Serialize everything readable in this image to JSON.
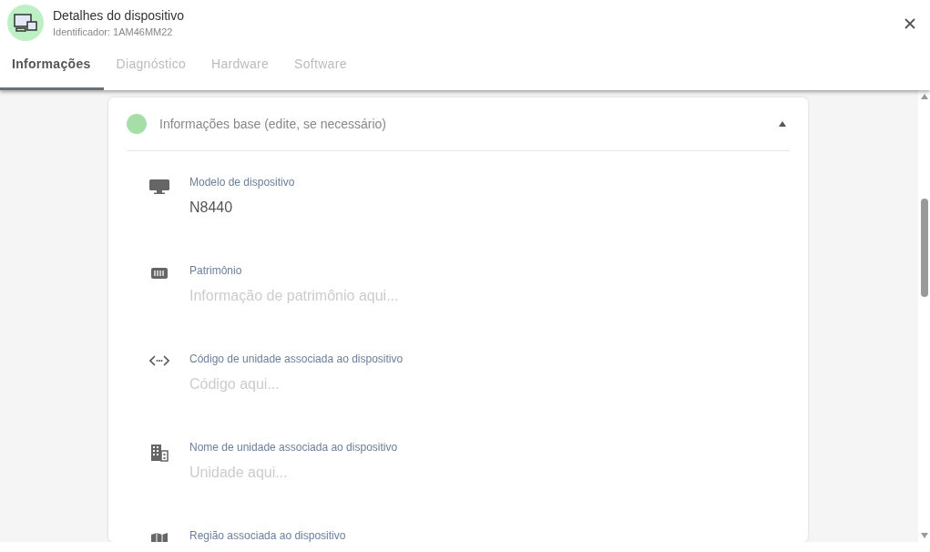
{
  "header": {
    "title": "Detalhes do dispositivo",
    "subtitle": "Identificador: 1AM46MM22"
  },
  "tabs": [
    {
      "label": "Informações",
      "selected": true
    },
    {
      "label": "Diagnóstico",
      "selected": false
    },
    {
      "label": "Hardware",
      "selected": false
    },
    {
      "label": "Software",
      "selected": false
    }
  ],
  "section": {
    "title": "Informações base (edite, se necessário)",
    "expanded": true,
    "fields": [
      {
        "kind": "monitor",
        "label": "Modelo de dispositivo",
        "value": "N8440"
      },
      {
        "kind": "tag",
        "label": "Patrimônio",
        "placeholder": "Informação de patrimônio aqui..."
      },
      {
        "kind": "code",
        "label": "Código de unidade associada ao dispositivo",
        "placeholder": "Código aqui..."
      },
      {
        "kind": "building",
        "label": "Nome de unidade associada ao dispositivo",
        "placeholder": "Unidade aqui..."
      },
      {
        "kind": "map",
        "label": "Região associada ao dispositivo"
      }
    ]
  }
}
